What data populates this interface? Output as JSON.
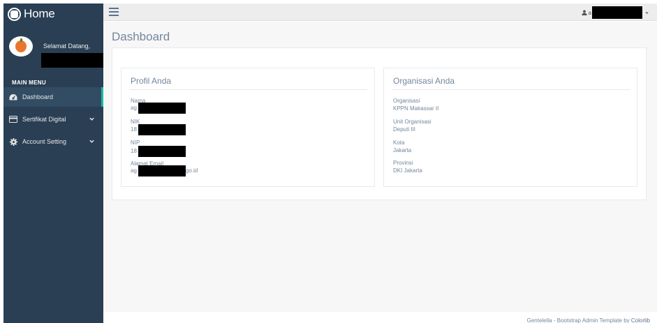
{
  "brand": {
    "title": "Home"
  },
  "profile": {
    "welcome": "Selamat Datang,"
  },
  "sidebar": {
    "section_title": "MAIN MENU",
    "items": [
      {
        "label": "Dashboard",
        "icon": "dashboard-icon",
        "active": true
      },
      {
        "label": "Sertifikat Digital",
        "icon": "credit-card-icon",
        "has_submenu": true
      },
      {
        "label": "Account Setting",
        "icon": "gear-icon",
        "has_submenu": true
      }
    ]
  },
  "topnav": {
    "user_initial": "a"
  },
  "page": {
    "title": "Dashboard"
  },
  "profil": {
    "title": "Profil Anda",
    "fields": [
      {
        "label": "Nama",
        "value_prefix": "ag",
        "value_suffix": ""
      },
      {
        "label": "NIK",
        "value_prefix": "18",
        "value_suffix": ""
      },
      {
        "label": "NIP",
        "value_prefix": "18",
        "value_suffix": ""
      },
      {
        "label": "Alamat Email",
        "value_prefix": "ag",
        "value_suffix": "go.id"
      }
    ]
  },
  "organisasi": {
    "title": "Organisasi Anda",
    "fields": [
      {
        "label": "Organisasi",
        "value": "KPPN Makassar II"
      },
      {
        "label": "Unit Organisasi",
        "value": "Deputi III"
      },
      {
        "label": "Kota",
        "value": "Jakarta"
      },
      {
        "label": "Provinsi",
        "value": "DKI Jakarta"
      }
    ]
  },
  "footer": {
    "text": "Gentelella - Bootstrap Admin Template by ",
    "link": "Colorlib"
  },
  "colors": {
    "sidebar_bg": "#2a3f54",
    "active_accent": "#1abb9c",
    "text": "#73879c"
  }
}
